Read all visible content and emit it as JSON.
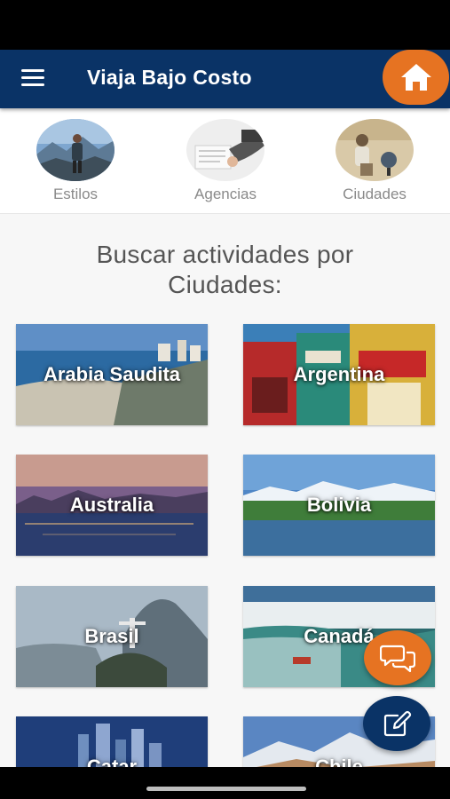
{
  "header": {
    "title": "Viaja Bajo Costo"
  },
  "categories": [
    {
      "label": "Estilos"
    },
    {
      "label": "Agencias"
    },
    {
      "label": "Ciudades"
    }
  ],
  "section_title_line1": "Buscar actividades por",
  "section_title_line2": "Ciudades:",
  "cities": [
    {
      "name": "Arabia Saudita"
    },
    {
      "name": "Argentina"
    },
    {
      "name": "Australia"
    },
    {
      "name": "Bolivia"
    },
    {
      "name": "Brasil"
    },
    {
      "name": "Canadá"
    },
    {
      "name": "Catar"
    },
    {
      "name": "Chile"
    }
  ],
  "colors": {
    "primary": "#0a3366",
    "accent": "#e67322"
  },
  "icons": {
    "menu": "menu-icon",
    "home": "home-icon",
    "chat": "chat-icon",
    "edit": "edit-icon"
  }
}
